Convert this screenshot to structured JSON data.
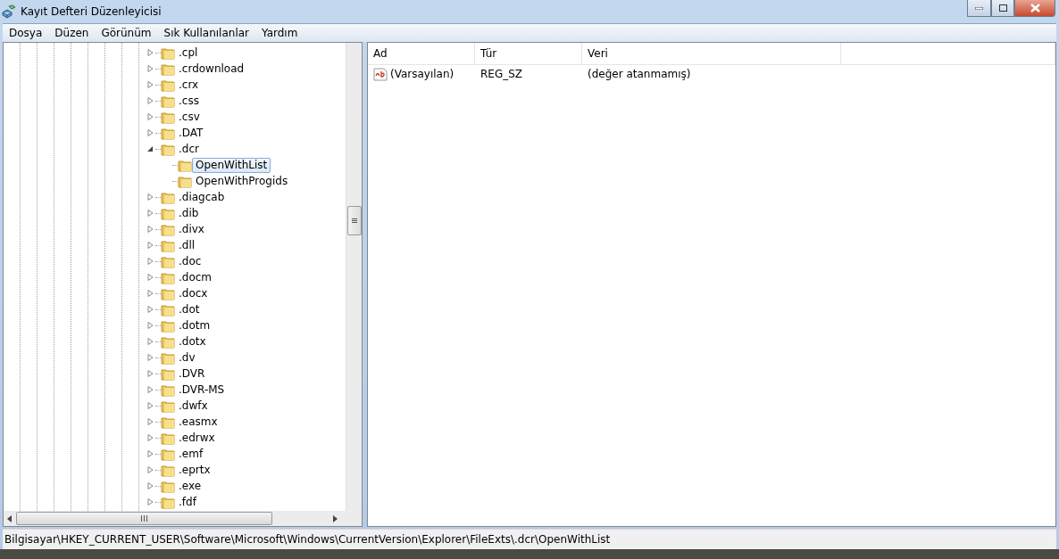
{
  "window": {
    "title": "Kayıt Defteri Düzenleyicisi"
  },
  "menu": [
    "Dosya",
    "Düzen",
    "Görünüm",
    "Sık Kullanılanlar",
    "Yardım"
  ],
  "tree": [
    {
      "label": ".cpl",
      "expanded": false,
      "selected": false
    },
    {
      "label": ".crdownload",
      "expanded": false,
      "selected": false
    },
    {
      "label": ".crx",
      "expanded": false,
      "selected": false
    },
    {
      "label": ".css",
      "expanded": false,
      "selected": false
    },
    {
      "label": ".csv",
      "expanded": false,
      "selected": false
    },
    {
      "label": ".DAT",
      "expanded": false,
      "selected": false
    },
    {
      "label": ".dcr",
      "expanded": true,
      "selected": false,
      "children": [
        {
          "label": "OpenWithList",
          "selected": true
        },
        {
          "label": "OpenWithProgids",
          "selected": false
        }
      ]
    },
    {
      "label": ".diagcab",
      "expanded": false,
      "selected": false
    },
    {
      "label": ".dib",
      "expanded": false,
      "selected": false
    },
    {
      "label": ".divx",
      "expanded": false,
      "selected": false
    },
    {
      "label": ".dll",
      "expanded": false,
      "selected": false
    },
    {
      "label": ".doc",
      "expanded": false,
      "selected": false
    },
    {
      "label": ".docm",
      "expanded": false,
      "selected": false
    },
    {
      "label": ".docx",
      "expanded": false,
      "selected": false
    },
    {
      "label": ".dot",
      "expanded": false,
      "selected": false
    },
    {
      "label": ".dotm",
      "expanded": false,
      "selected": false
    },
    {
      "label": ".dotx",
      "expanded": false,
      "selected": false
    },
    {
      "label": ".dv",
      "expanded": false,
      "selected": false
    },
    {
      "label": ".DVR",
      "expanded": false,
      "selected": false
    },
    {
      "label": ".DVR-MS",
      "expanded": false,
      "selected": false
    },
    {
      "label": ".dwfx",
      "expanded": false,
      "selected": false
    },
    {
      "label": ".easmx",
      "expanded": false,
      "selected": false
    },
    {
      "label": ".edrwx",
      "expanded": false,
      "selected": false
    },
    {
      "label": ".emf",
      "expanded": false,
      "selected": false
    },
    {
      "label": ".eprtx",
      "expanded": false,
      "selected": false
    },
    {
      "label": ".exe",
      "expanded": false,
      "selected": false
    },
    {
      "label": ".fdf",
      "expanded": false,
      "selected": false
    }
  ],
  "values": {
    "columns": [
      "Ad",
      "Tür",
      "Veri"
    ],
    "rows": [
      {
        "name": "(Varsayılan)",
        "type": "REG_SZ",
        "data": "(değer atanmamış)"
      }
    ]
  },
  "status_bar": "Bilgisayar\\HKEY_CURRENT_USER\\Software\\Microsoft\\Windows\\CurrentVersion\\Explorer\\FileExts\\.dcr\\OpenWithList"
}
